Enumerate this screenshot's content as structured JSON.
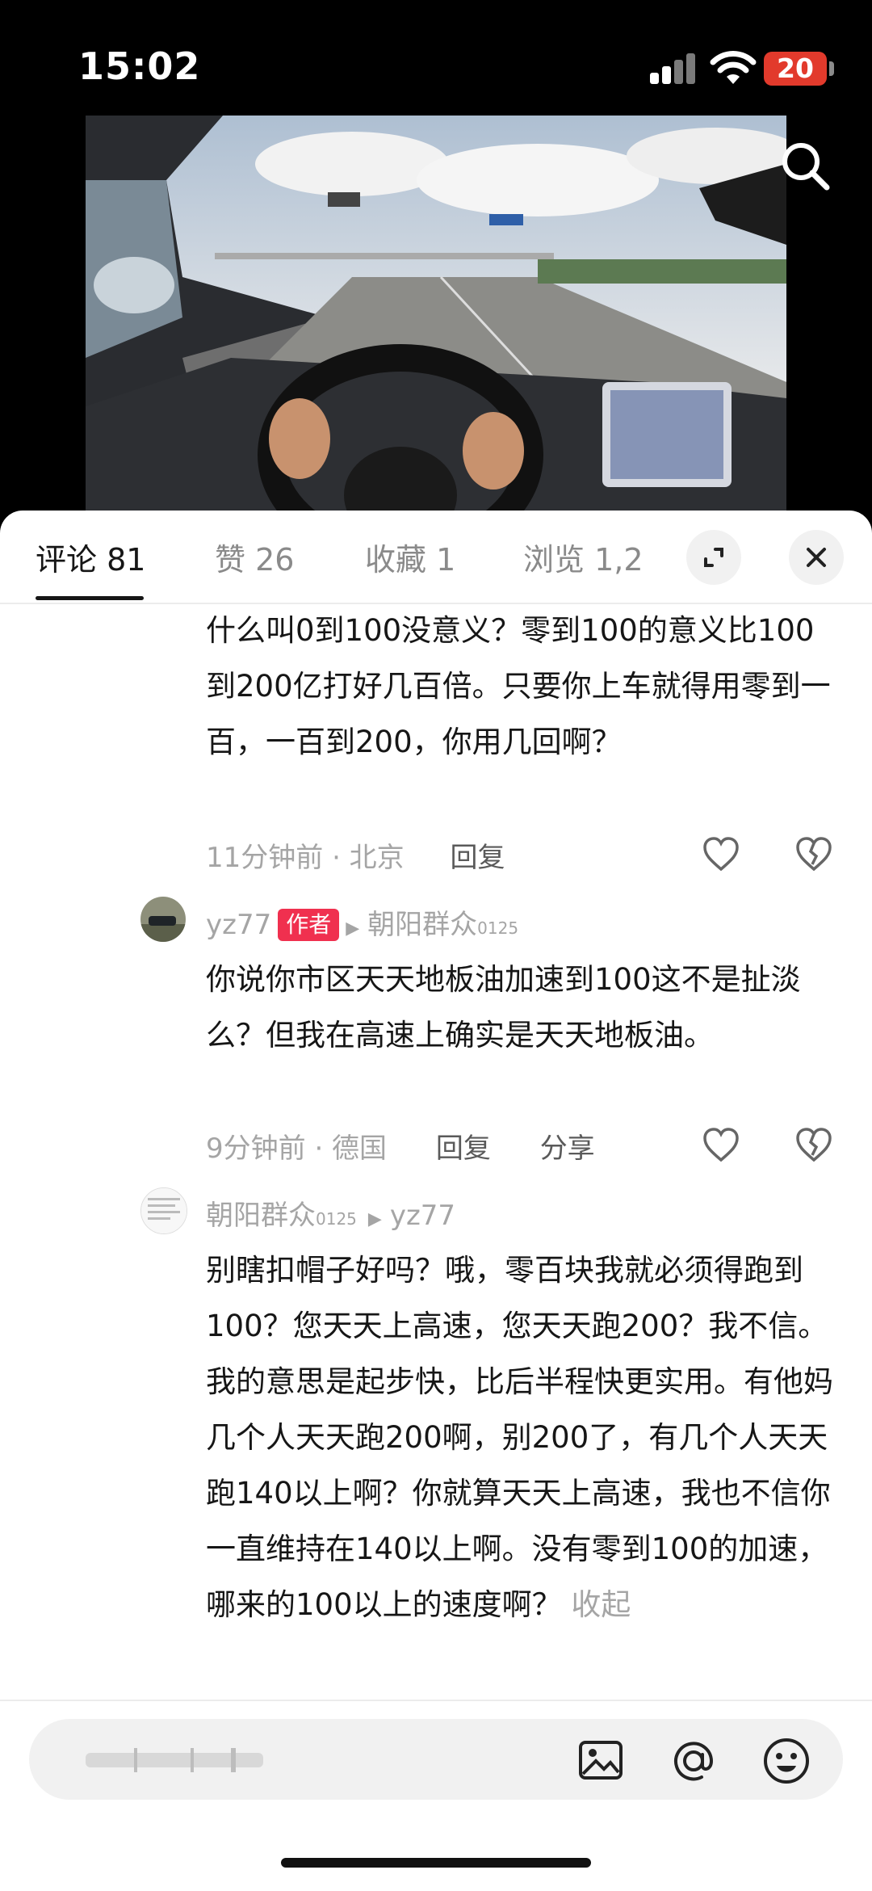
{
  "status_bar": {
    "time": "15:02",
    "battery": "20"
  },
  "tabs": [
    {
      "label": "评论 81"
    },
    {
      "label": "赞 26"
    },
    {
      "label": "收藏 1"
    },
    {
      "label": "浏览 1,2"
    }
  ],
  "comments": [
    {
      "text": "什么叫0到100没意义？零到100的意义比100到200亿打好几百倍。只要你上车就得用零到一百，一百到200，你用几回啊？",
      "time_location": "11分钟前 · 北京",
      "reply": "回复"
    },
    {
      "username": "yz77",
      "badge": "作者",
      "reply_to": "朝阳群众",
      "reply_to_suffix": "0125",
      "text": "你说你市区天天地板油加速到100这不是扯淡么？但我在高速上确实是天天地板油。",
      "time_location": "9分钟前 · 德国",
      "reply": "回复",
      "share": "分享"
    },
    {
      "username": "朝阳群众",
      "username_suffix": "0125",
      "reply_to": "yz77",
      "text": "别瞎扣帽子好吗？哦，零百块我就必须得跑到100？您天天上高速，您天天跑200？我不信。我的意思是起步快，比后半程快更实用。有他妈几个人天天跑200啊，别200了，有几个人天天跑140以上啊？你就算天天上高速，我也不信你一直维持在140以上啊。没有零到100的加速，哪来的100以上的速度啊？",
      "collapse": "收起"
    }
  ],
  "icons": {
    "search": "search-icon",
    "expand": "expand-icon",
    "close": "close-icon",
    "like": "heart-icon",
    "dislike": "broken-heart-icon",
    "image": "image-icon",
    "mention": "at-icon",
    "emoji": "emoji-icon"
  },
  "colors": {
    "author_badge": "#f0304f",
    "battery": "#e23a2c"
  }
}
